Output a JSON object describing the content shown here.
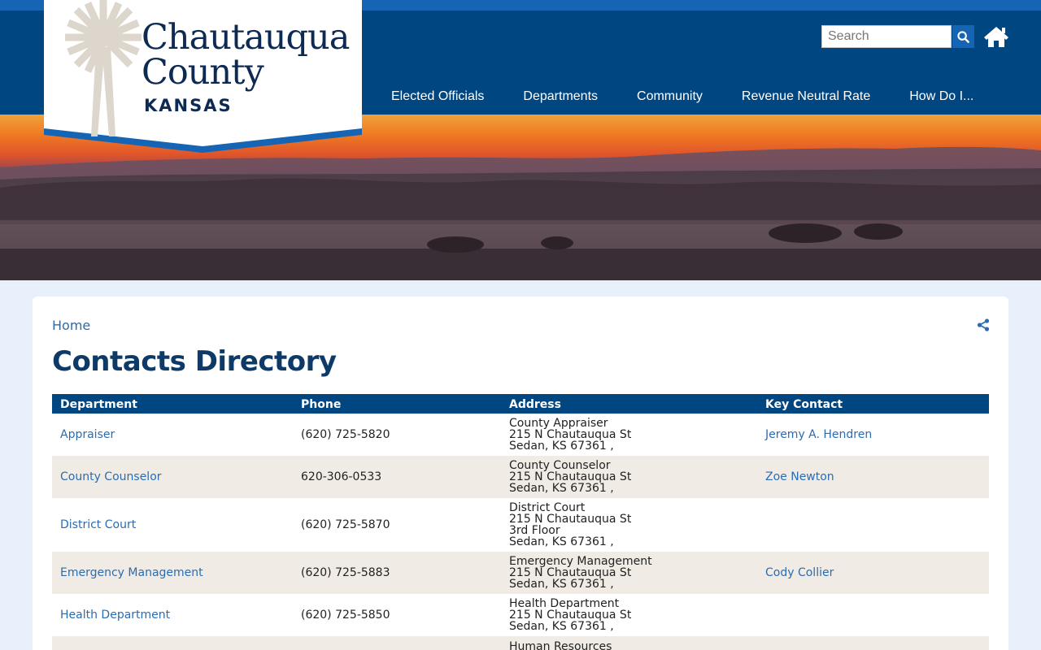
{
  "logo": {
    "line1": "Chautauqua",
    "line2": "County",
    "line3": "KANSAS"
  },
  "search": {
    "placeholder": "Search"
  },
  "icons": {
    "search": "search-icon",
    "home": "home-icon",
    "share": "share-icon",
    "logo": "windmill-icon"
  },
  "colors": {
    "header": "#004680",
    "accent": "#1565b4",
    "title": "#0d3a66",
    "link": "#2b6cb0",
    "row_alt": "#f0ece5"
  },
  "nav": [
    {
      "label": "Elected Officials"
    },
    {
      "label": "Departments"
    },
    {
      "label": "Community"
    },
    {
      "label": "Revenue Neutral Rate"
    },
    {
      "label": "How Do I..."
    }
  ],
  "breadcrumb": {
    "home": "Home"
  },
  "page": {
    "title": "Contacts Directory"
  },
  "table": {
    "headers": {
      "department": "Department",
      "phone": "Phone",
      "address": "Address",
      "key_contact": "Key Contact"
    },
    "rows": [
      {
        "department": "Appraiser",
        "phone": "(620) 725-5820",
        "address": [
          "County Appraiser",
          "215 N Chautauqua St",
          "Sedan, KS 67361 ,"
        ],
        "key_contact": "Jeremy A. Hendren"
      },
      {
        "department": "County Counselor",
        "phone": "620-306-0533",
        "address": [
          "County Counselor",
          "215 N Chautauqua St",
          "Sedan, KS 67361 ,"
        ],
        "key_contact": "Zoe Newton"
      },
      {
        "department": "District Court",
        "phone": "(620) 725-5870",
        "address": [
          "District Court",
          "215 N Chautauqua St",
          "3rd Floor",
          "Sedan, KS 67361 ,"
        ],
        "key_contact": ""
      },
      {
        "department": "Emergency Management",
        "phone": "(620) 725-5883",
        "address": [
          "Emergency Management",
          "215 N Chautauqua St",
          "Sedan, KS 67361 ,"
        ],
        "key_contact": "Cody Collier"
      },
      {
        "department": "Health Department",
        "phone": "(620) 725-5850",
        "address": [
          "Health Department",
          "215 N Chautauqua St",
          "Sedan, KS 67361 ,"
        ],
        "key_contact": ""
      },
      {
        "department": "",
        "phone": "",
        "address": [
          "Human Resources"
        ],
        "key_contact": ""
      }
    ]
  }
}
